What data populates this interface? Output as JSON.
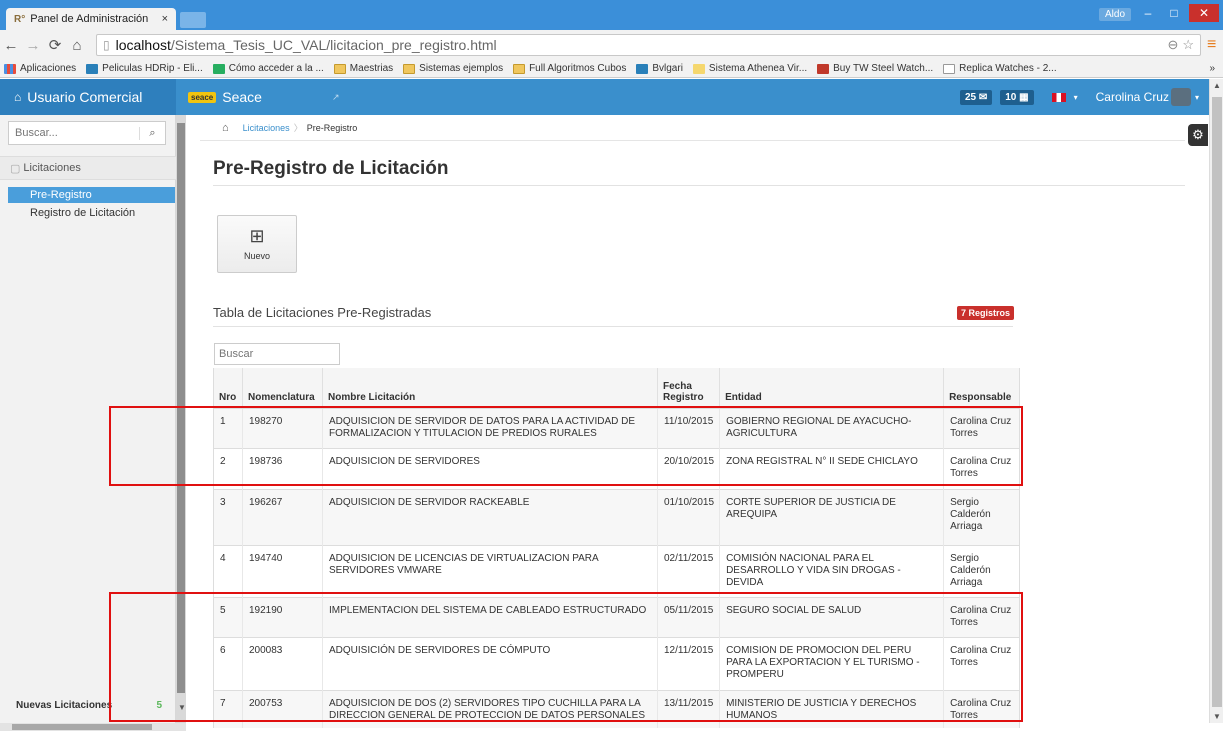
{
  "browser": {
    "tab_title": "Panel de Administración",
    "tab_favicon": "R°",
    "tab_close": "×",
    "window_user": "Aldo",
    "min": "–",
    "max": "□",
    "close": "✕",
    "url_host": "localhost",
    "url_path": "/Sistema_Tesis_UC_VAL/licitacion_pre_registro.html",
    "bookmarks": [
      {
        "label": "Aplicaciones",
        "icon": "apps-icon"
      },
      {
        "label": "Peliculas HDRip - Eli...",
        "icon": "hd-icon"
      },
      {
        "label": "Cómo acceder a la ...",
        "icon": "green-page-icon"
      },
      {
        "label": "Maestrias",
        "icon": "folder-icon"
      },
      {
        "label": "Sistemas ejemplos",
        "icon": "folder-icon"
      },
      {
        "label": "Full Algoritmos Cubos",
        "icon": "folder-icon"
      },
      {
        "label": "Bvlgari",
        "icon": "shop-icon"
      },
      {
        "label": "Sistema Athenea Vir...",
        "icon": "circle-icon"
      },
      {
        "label": "Buy TW Steel Watch...",
        "icon": "red-badge-icon"
      },
      {
        "label": "Replica Watches - 2...",
        "icon": "page-icon"
      }
    ],
    "bookmarks_more": "»"
  },
  "appbar": {
    "brand": "Usuario Comercial",
    "logo_text": "seace",
    "module": "Seace",
    "badge_mail": "25",
    "badge_cal": "10",
    "user_name": "Carolina Cruz"
  },
  "sidebar": {
    "search_placeholder": "Buscar...",
    "section": "Licitaciones",
    "items": [
      {
        "label": "Pre-Registro",
        "active": true
      },
      {
        "label": "Registro de Licitación",
        "active": false
      }
    ],
    "footer_label": "Nuevas Licitaciones",
    "footer_count": "5"
  },
  "breadcrumb": {
    "parent": "Licitaciones",
    "current": "Pre-Registro"
  },
  "page": {
    "title": "Pre-Registro de Licitación",
    "new_button": "Nuevo",
    "table_title": "Tabla de Licitaciones Pre-Registradas",
    "records_badge": "7 Registros",
    "table_search_placeholder": "Buscar"
  },
  "table": {
    "headers": {
      "nro": "Nro",
      "nomenclatura": "Nomenclatura",
      "nombre": "Nombre Licitación",
      "fecha_1": "Fecha",
      "fecha_2": "Registro",
      "entidad": "Entidad",
      "responsable": "Responsable"
    },
    "rows": [
      {
        "nro": "1",
        "nomenclatura": "198270",
        "nombre": "ADQUISICION DE SERVIDOR DE DATOS PARA LA ACTIVIDAD DE FORMALIZACION Y TITULACION DE PREDIOS RURALES",
        "fecha": "11/10/2015",
        "entidad": "GOBIERNO REGIONAL DE AYACUCHO-AGRICULTURA",
        "responsable": "Carolina Cruz Torres"
      },
      {
        "nro": "2",
        "nomenclatura": "198736",
        "nombre": "ADQUISICION DE SERVIDORES",
        "fecha": "20/10/2015",
        "entidad": "ZONA REGISTRAL N° II SEDE CHICLAYO",
        "responsable": "Carolina Cruz Torres"
      },
      {
        "nro": "3",
        "nomenclatura": "196267",
        "nombre": "ADQUISICION DE SERVIDOR RACKEABLE",
        "fecha": "01/10/2015",
        "entidad": "CORTE SUPERIOR DE JUSTICIA DE AREQUIPA",
        "responsable": "Sergio Calderón Arriaga"
      },
      {
        "nro": "4",
        "nomenclatura": "194740",
        "nombre": "ADQUISICION DE LICENCIAS DE VIRTUALIZACION PARA SERVIDORES VMWARE",
        "fecha": "02/11/2015",
        "entidad": "COMISIÓN NACIONAL PARA EL DESARROLLO Y VIDA SIN DROGAS - DEVIDA",
        "responsable": "Sergio Calderón Arriaga"
      },
      {
        "nro": "5",
        "nomenclatura": "192190",
        "nombre": "IMPLEMENTACION DEL SISTEMA DE CABLEADO ESTRUCTURADO",
        "fecha": "05/11/2015",
        "entidad": "SEGURO SOCIAL DE SALUD",
        "responsable": "Carolina Cruz Torres"
      },
      {
        "nro": "6",
        "nomenclatura": "200083",
        "nombre": "ADQUISICIÓN DE SERVIDORES DE CÓMPUTO",
        "fecha": "12/11/2015",
        "entidad": "COMISION DE PROMOCION DEL PERU PARA LA EXPORTACION Y EL TURISMO - PROMPERU",
        "responsable": "Carolina Cruz Torres"
      },
      {
        "nro": "7",
        "nomenclatura": "200753",
        "nombre": "ADQUISICION DE DOS (2) SERVIDORES TIPO CUCHILLA PARA LA DIRECCION GENERAL DE PROTECCION DE DATOS PERSONALES",
        "fecha": "13/11/2015",
        "entidad": "MINISTERIO DE JUSTICIA Y DERECHOS HUMANOS",
        "responsable": "Carolina Cruz Torres"
      }
    ]
  },
  "colors": {
    "brand_blue": "#2e7fbd",
    "nav_blue": "#3a8fcc",
    "active_item": "#4a9edb",
    "badge_red": "#c9302c",
    "highlight_red": "#e01010"
  }
}
